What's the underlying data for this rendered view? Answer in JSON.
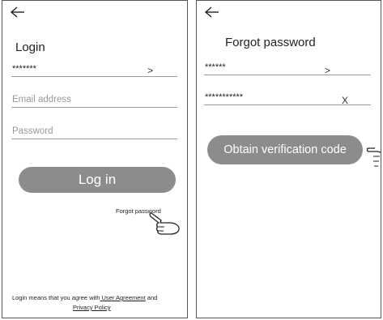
{
  "login": {
    "title": "Login",
    "account_value": "*******",
    "account_suffix": ">",
    "email_placeholder": "Email address",
    "password_placeholder": "Password",
    "login_button": "Log in",
    "forgot_link": "Forgot password",
    "terms_prefix": "Login means that you agree with",
    "terms_link": " User Agreement",
    "terms_and": " and",
    "privacy_link": "Privacy Policy "
  },
  "forgot": {
    "title": "Forgot password",
    "account_value": "******",
    "account_suffix": ">",
    "code_value": "***********",
    "code_suffix": "X",
    "obtain_button": "Obtain verification code"
  },
  "icons": {
    "back": "left-arrow-icon",
    "pointer": "hand-pointer-icon"
  }
}
